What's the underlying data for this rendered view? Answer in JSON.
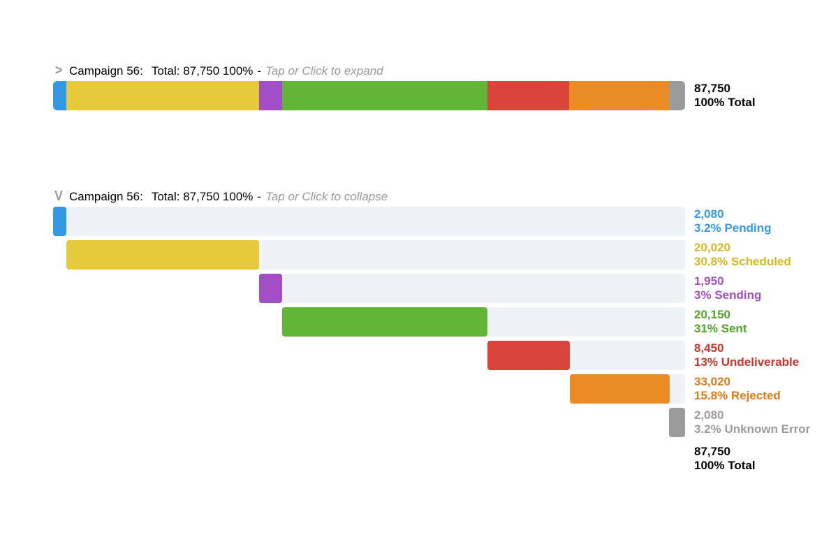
{
  "chart_data": {
    "type": "bar",
    "title": "Campaign 56",
    "total_value": 87750,
    "total_label": "87,750",
    "total_percent": "100%",
    "series": [
      {
        "name": "Pending",
        "value": 2080,
        "value_label": "2,080",
        "percent": "3.2%",
        "color": "#3399e6"
      },
      {
        "name": "Scheduled",
        "value": 20020,
        "value_label": "20,020",
        "percent": "30.8%",
        "color": "#e7c93c"
      },
      {
        "name": "Sending",
        "value": 1950,
        "value_label": "1,950",
        "percent": "3%",
        "color": "#a24fc7"
      },
      {
        "name": "Sent",
        "value": 20150,
        "value_label": "20,150",
        "percent": "31%",
        "color": "#63b538"
      },
      {
        "name": "Undeliverable",
        "value": 8450,
        "value_label": "8,450",
        "percent": "13%",
        "color": "#d9453a"
      },
      {
        "name": "Rejected",
        "value": 33020,
        "value_label": "33,020",
        "percent": "15.8%",
        "color": "#ea8b24"
      },
      {
        "name": "Unknown Error",
        "value": 2080,
        "value_label": "2,080",
        "percent": "3.2%",
        "color": "#9b9b9b"
      }
    ]
  },
  "collapsed": {
    "chevron": ">",
    "title": "Campaign 56:",
    "summary": "Total: 87,750 100%",
    "dash": "-",
    "hint": "Tap or Click to expand",
    "side_total_value": "87,750",
    "side_total_detail": "100% Total"
  },
  "expanded": {
    "chevron": "V",
    "title": "Campaign 56:",
    "summary": "Total: 87,750 100%",
    "dash": "-",
    "hint": "Tap or Click to collapse",
    "rows": {
      "pending": {
        "value": "2,080",
        "detail": "3.2% Pending"
      },
      "scheduled": {
        "value": "20,020",
        "detail": "30.8% Scheduled"
      },
      "sending": {
        "value": "1,950",
        "detail": "3% Sending"
      },
      "sent": {
        "value": "20,150",
        "detail": "31% Sent"
      },
      "undeliverable": {
        "value": "8,450",
        "detail": "13% Undeliverable"
      },
      "rejected": {
        "value": "33,020",
        "detail": "15.8% Rejected"
      },
      "unknown": {
        "value": "2,080",
        "detail": "3.2% Unknown Error"
      },
      "total": {
        "value": "87,750",
        "detail": "100% Total"
      }
    }
  },
  "colors": {
    "pending": "#3399e6",
    "scheduled": "#e7c93c",
    "sending": "#a24fc7",
    "sent": "#63b538",
    "undeliv": "#d9453a",
    "rejected": "#ea8b24",
    "unknown": "#9b9b9b",
    "track": "#eef2f6",
    "total_text": "#000000"
  }
}
